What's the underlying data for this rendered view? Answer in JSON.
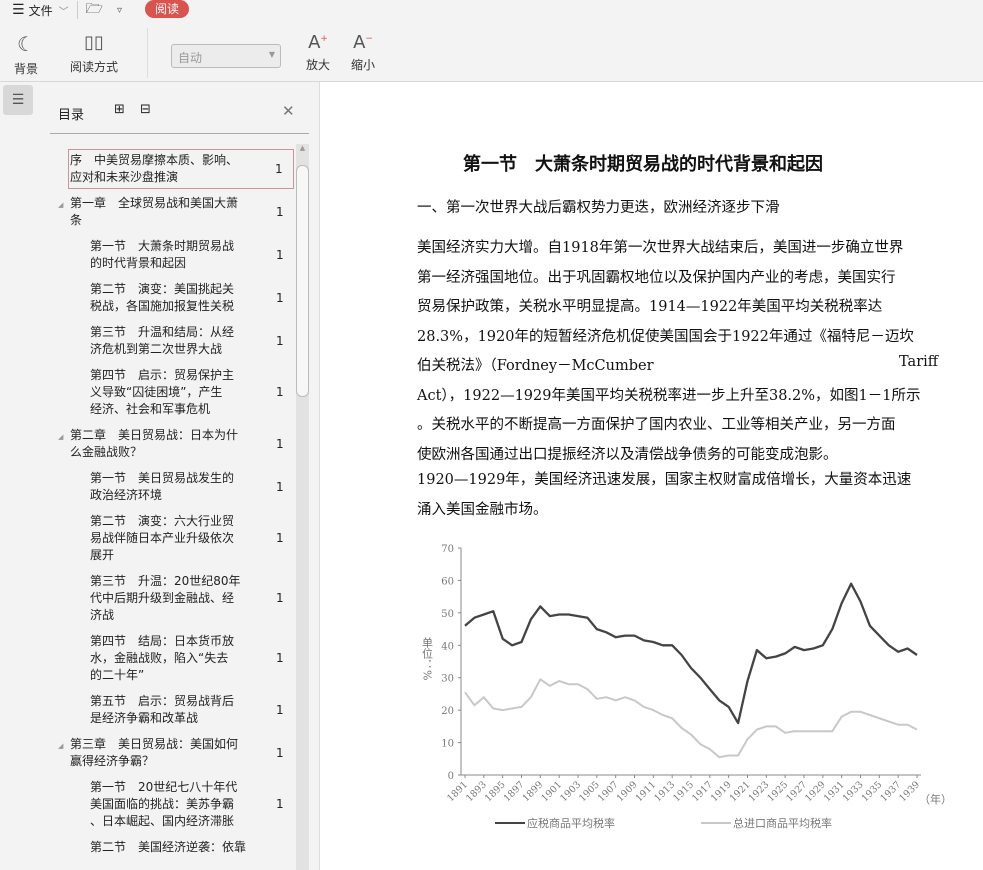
{
  "menu": {
    "file": "文件",
    "read_badge": "阅读"
  },
  "toolbar": {
    "background": "背景",
    "read_mode": "阅读方式",
    "zoom_select": "自动",
    "zoom_in": "放大",
    "zoom_out": "缩小"
  },
  "toc": {
    "title": "目录",
    "items": [
      {
        "level": 0,
        "lines": [
          "序　中美贸易摩擦本质、影响、",
          "应对和未来沙盘推演"
        ],
        "page": "1",
        "selected": true
      },
      {
        "level": 0,
        "lines": [
          "第一章　全球贸易战和美国大萧",
          "条"
        ],
        "page": "1",
        "expand": true
      },
      {
        "level": 1,
        "lines": [
          "第一节　大萧条时期贸易战",
          "的时代背景和起因"
        ],
        "page": "1"
      },
      {
        "level": 1,
        "lines": [
          "第二节　演变：美国挑起关",
          "税战，各国施加报复性关税"
        ],
        "page": "1"
      },
      {
        "level": 1,
        "lines": [
          "第三节　升温和结局：从经",
          "济危机到第二次世界大战"
        ],
        "page": "1"
      },
      {
        "level": 1,
        "lines": [
          "第四节　启示：贸易保护主",
          "义导致“囚徒困境”，产生",
          "经济、社会和军事危机"
        ],
        "page": "1"
      },
      {
        "level": 0,
        "lines": [
          "第二章　美日贸易战：日本为什",
          "么金融战败？"
        ],
        "page": "1",
        "expand": true
      },
      {
        "level": 1,
        "lines": [
          "第一节　美日贸易战发生的",
          "政治经济环境"
        ],
        "page": "1"
      },
      {
        "level": 1,
        "lines": [
          "第二节　演变：六大行业贸",
          "易战伴随日本产业升级依次",
          "展开"
        ],
        "page": "1"
      },
      {
        "level": 1,
        "lines": [
          "第三节　升温：20世纪80年",
          "代中后期升级到金融战、经",
          "济战"
        ],
        "page": "1"
      },
      {
        "level": 1,
        "lines": [
          "第四节　结局：日本货币放",
          "水，金融战败，陷入“失去",
          "的二十年”"
        ],
        "page": "1"
      },
      {
        "level": 1,
        "lines": [
          "第五节　启示：贸易战背后",
          "是经济争霸和改革战"
        ],
        "page": "1"
      },
      {
        "level": 0,
        "lines": [
          "第三章　美日贸易战：美国如何",
          "赢得经济争霸？"
        ],
        "page": "1",
        "expand": true
      },
      {
        "level": 1,
        "lines": [
          "第一节　20世纪七八十年代",
          "美国面临的挑战：美苏争霸",
          "、日本崛起、国内经济滞胀"
        ],
        "page": "1"
      },
      {
        "level": 1,
        "lines": [
          "第二节　美国经济逆袭：依靠"
        ],
        "page": ""
      }
    ]
  },
  "doc": {
    "title": "第一节　大萧条时期贸易战的时代背景和起因",
    "subtitle": "一、第一次世界大战后霸权势力更迭，欧洲经济逐步下滑",
    "lines": [
      "美国经济实力大增。自1918年第一次世界大战结束后，美国进一步确立世界",
      "第一经济强国地位。出于巩固霸权地位以及保护国内产业的考虑，美国实行",
      "贸易保护政策，关税水平明显提高。1914—1922年美国平均关税税率达",
      "28.3%，1920年的短暂经济危机促使美国国会于1922年通过《福特尼－迈坎",
      "伯关税法》（Fordney－McCumber",
      "Act），1922—1929年美国平均关税税率进一步上升至38.2%，如图1－1所示",
      "。关税水平的不断提高一方面保护了国内农业、工业等相关产业，另一方面",
      "使欧洲各国通过出口提振经济以及清偿战争债务的可能变成泡影。",
      "1920—1929年，美国经济迅速发展，国家主权财富成倍增长，大量资本迅速",
      "涌入美国金融市场。"
    ],
    "tariff": "Tariff"
  },
  "chart_data": {
    "type": "line",
    "ylabel": "单位：%",
    "xlabel": "（年）",
    "ylim": [
      0,
      70
    ],
    "yticks": [
      0,
      10,
      20,
      30,
      40,
      50,
      60,
      70
    ],
    "x": [
      1891,
      1892,
      1893,
      1894,
      1895,
      1896,
      1897,
      1898,
      1899,
      1900,
      1901,
      1902,
      1903,
      1904,
      1905,
      1906,
      1907,
      1908,
      1909,
      1910,
      1911,
      1912,
      1913,
      1914,
      1915,
      1916,
      1917,
      1918,
      1919,
      1920,
      1921,
      1922,
      1923,
      1924,
      1925,
      1926,
      1927,
      1928,
      1929,
      1930,
      1931,
      1932,
      1933,
      1934,
      1935,
      1936,
      1937,
      1938,
      1939
    ],
    "xticks": [
      "1891",
      "1893",
      "1895",
      "1897",
      "1899",
      "1901",
      "1903",
      "1905",
      "1907",
      "1909",
      "1911",
      "1913",
      "1915",
      "1917",
      "1919",
      "1921",
      "1923",
      "1925",
      "1927",
      "1929",
      "1931",
      "1933",
      "1935",
      "1937",
      "1939"
    ],
    "series": [
      {
        "name": "应税商品平均税率",
        "color": "#444444",
        "values": [
          46,
          48.5,
          49.5,
          50.5,
          42,
          40,
          41,
          48,
          52,
          49,
          49.5,
          49.5,
          49,
          48.5,
          45,
          44,
          42.5,
          43,
          43,
          41.5,
          41,
          40,
          40,
          37,
          33,
          30,
          26.5,
          23,
          21,
          16,
          29,
          38.5,
          36,
          36.5,
          37.5,
          39.5,
          38.5,
          39,
          40,
          45,
          53,
          59,
          53.5,
          46,
          43,
          40,
          38,
          39,
          37
        ]
      },
      {
        "name": "总进口商品平均税率",
        "color": "#c8c8c8",
        "values": [
          25.5,
          21.5,
          24,
          20.5,
          20,
          20.5,
          21,
          24,
          29.5,
          27.5,
          29,
          28,
          28,
          26.5,
          23.5,
          24,
          23,
          24,
          23,
          21,
          20,
          18.5,
          17.5,
          14.5,
          12.5,
          9.5,
          8,
          5.5,
          6,
          6,
          11,
          14,
          15,
          15,
          13,
          13.5,
          13.5,
          13.5,
          13.5,
          13.5,
          18,
          19.5,
          19.5,
          18.5,
          17.5,
          16.5,
          15.5,
          15.5,
          14
        ]
      }
    ]
  }
}
